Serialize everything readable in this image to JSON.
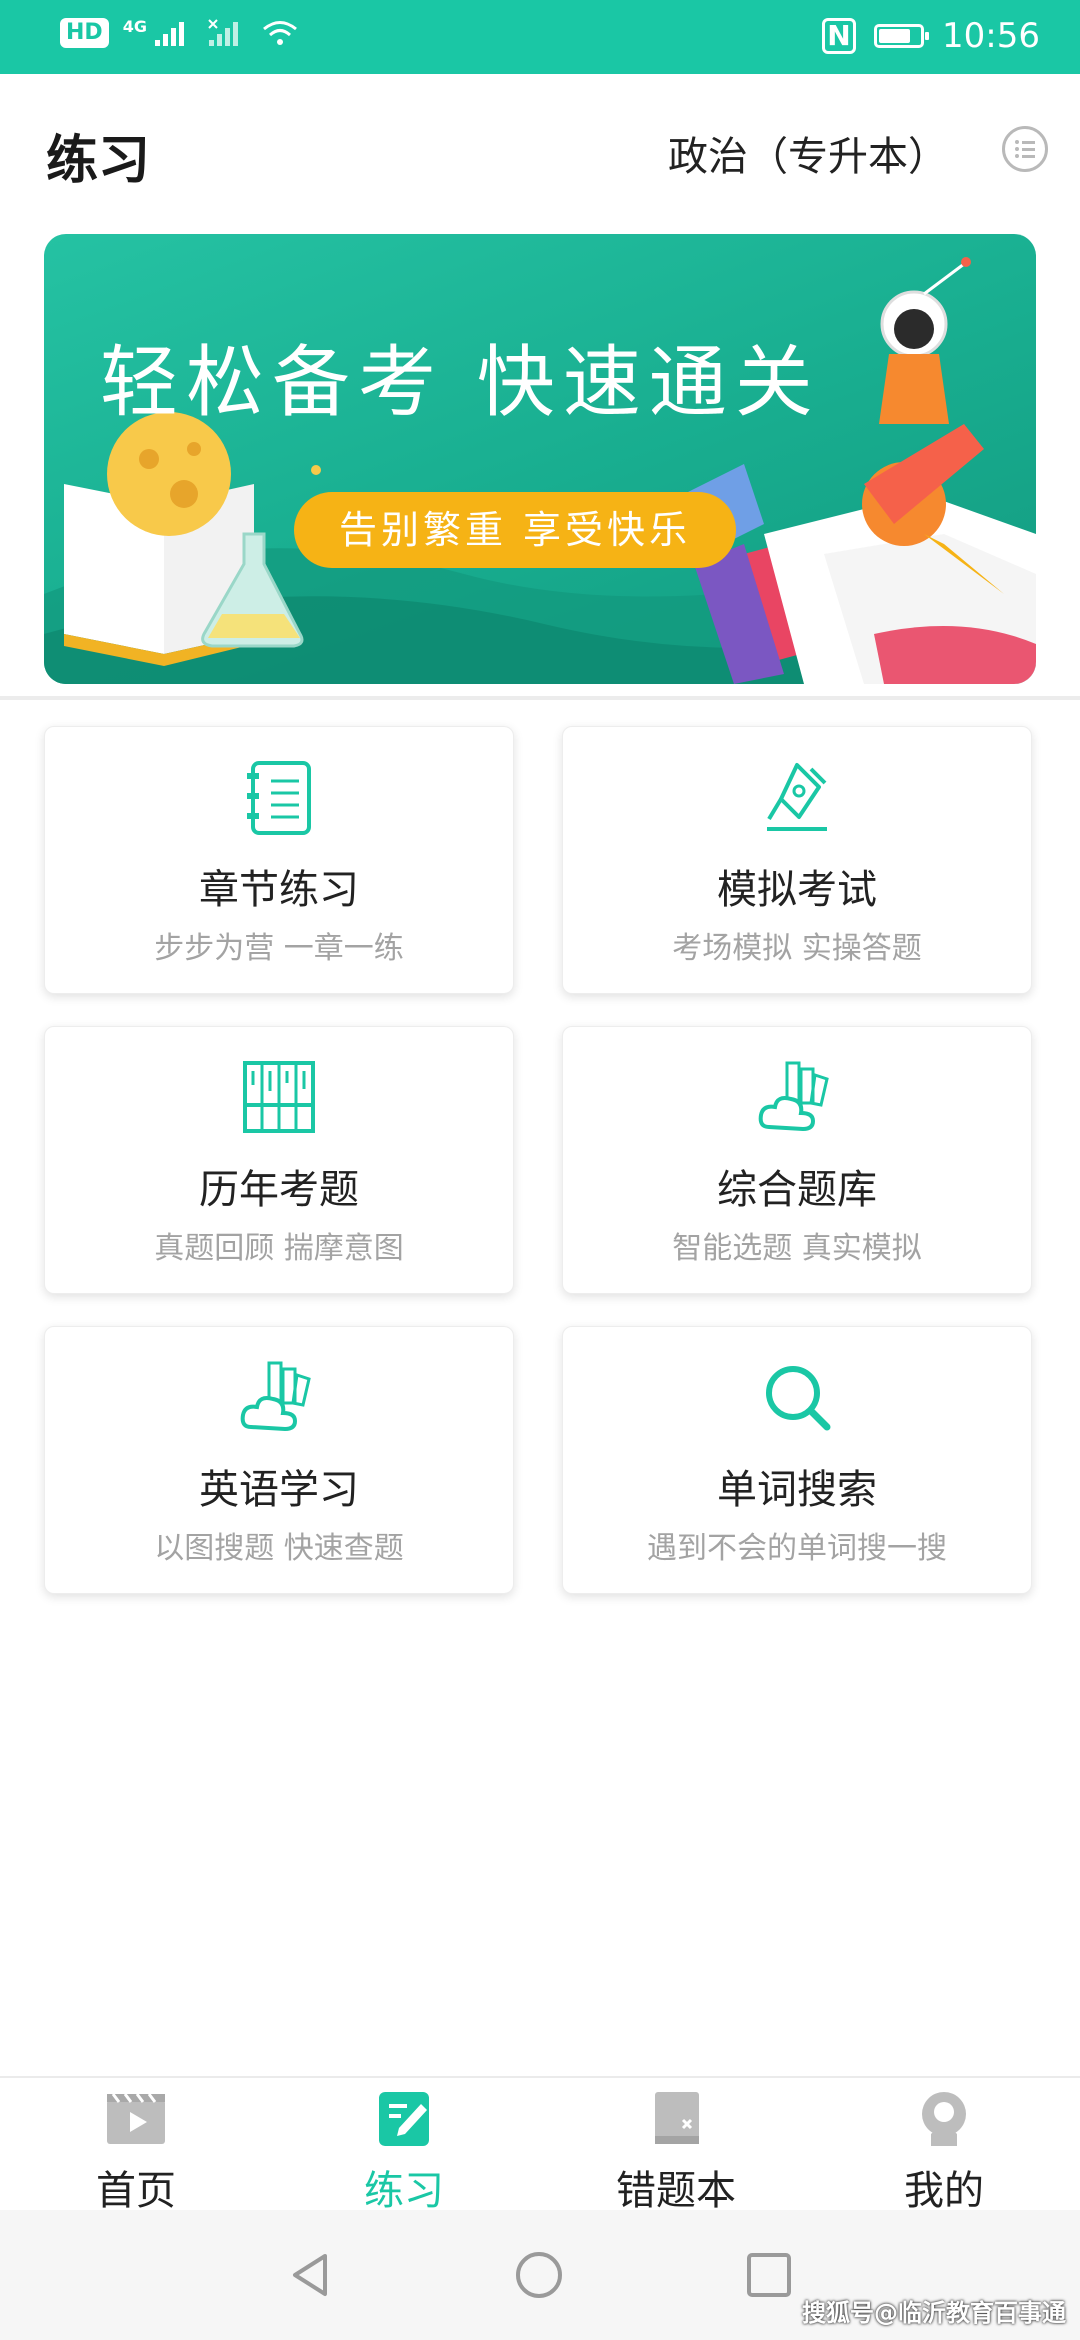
{
  "status_bar": {
    "left_badge": "HD",
    "network": "4G",
    "time": "10:56",
    "battery_level": 0.8
  },
  "header": {
    "title": "练习",
    "subject": "政治（专升本）"
  },
  "banner": {
    "headline": "轻松备考  快速通关",
    "pill": "告别繁重  享受快乐"
  },
  "cards": [
    {
      "title": "章节练习",
      "subtitle": "步步为营 一章一练",
      "icon": "notebook-icon"
    },
    {
      "title": "模拟考试",
      "subtitle": "考场模拟 实操答题",
      "icon": "pen-nib-icon"
    },
    {
      "title": "历年考题",
      "subtitle": "真题回顾 揣摩意图",
      "icon": "archive-grid-icon"
    },
    {
      "title": "综合题库",
      "subtitle": "智能选题 真实模拟",
      "icon": "cloud-books-icon"
    },
    {
      "title": "英语学习",
      "subtitle": "以图搜题 快速查题",
      "icon": "cloud-books-icon"
    },
    {
      "title": "单词搜索",
      "subtitle": "遇到不会的单词搜一搜",
      "icon": "search-icon"
    }
  ],
  "tabs": [
    {
      "label": "首页",
      "icon": "video-icon",
      "active": false
    },
    {
      "label": "练习",
      "icon": "practice-icon",
      "active": true
    },
    {
      "label": "错题本",
      "icon": "mistake-book-icon",
      "active": false
    },
    {
      "label": "我的",
      "icon": "profile-icon",
      "active": false
    }
  ],
  "watermark": "搜狐号@临沂教育百事通",
  "colors": {
    "accent": "#1ac7a5",
    "banner": "#18ad8f",
    "pill": "#f6b315"
  }
}
